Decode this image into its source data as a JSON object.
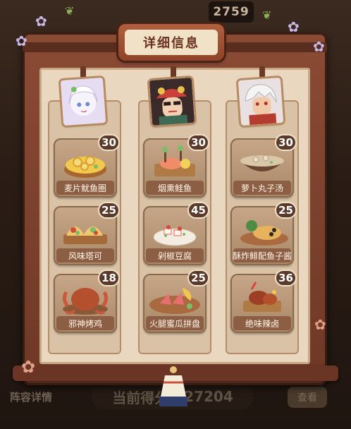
{
  "background": {
    "top_score": "2759",
    "bottom_label": "阵容详情",
    "bottom_score_label": "当前得分",
    "bottom_score_value": "227204",
    "bottom_button": "查看"
  },
  "panel": {
    "title": "详细信息"
  },
  "colors": {
    "frame": "#7a4029",
    "parchment": "#e9d7c0",
    "badge": "#5a3a2a",
    "name_plate": "#8c5e44"
  },
  "characters": [
    {
      "avatar_icon": "white-haired-girl-avatar-icon",
      "dishes": [
        {
          "name": "麦片鱿鱼圈",
          "score": "30",
          "icon": "squid-ring-bowl-icon"
        },
        {
          "name": "风味塔可",
          "score": "25",
          "icon": "taco-platter-icon"
        },
        {
          "name": "邪神烤鸡",
          "score": "18",
          "icon": "roast-chicken-tentacles-icon"
        }
      ]
    },
    {
      "avatar_icon": "opera-mask-boy-avatar-icon",
      "dishes": [
        {
          "name": "烟熏鲑鱼",
          "score": "30",
          "icon": "smoked-salmon-board-icon"
        },
        {
          "name": "剁椒豆腐",
          "score": "45",
          "icon": "chili-tofu-plate-icon"
        },
        {
          "name": "火腿蜜瓜拼盘",
          "score": "25",
          "icon": "ham-melon-platter-icon"
        }
      ]
    },
    {
      "avatar_icon": "silver-haired-warrior-avatar-icon",
      "dishes": [
        {
          "name": "萝卜丸子汤",
          "score": "30",
          "icon": "radish-meatball-soup-icon"
        },
        {
          "name": "酥炸鲱配鱼子酱",
          "score": "25",
          "icon": "fried-fish-caviar-icon"
        },
        {
          "name": "绝味辣卤",
          "score": "36",
          "icon": "spicy-braised-platter-icon"
        }
      ]
    }
  ]
}
